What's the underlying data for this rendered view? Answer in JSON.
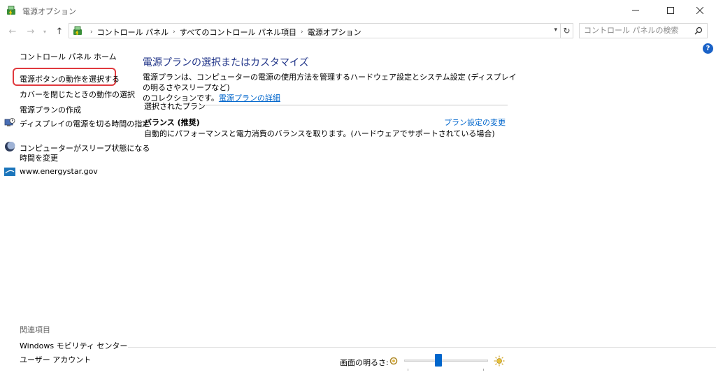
{
  "window": {
    "title": "電源オプション",
    "accent": "#1e3287"
  },
  "address": {
    "crumbs": [
      "コントロール パネル",
      "すべてのコントロール パネル項目",
      "電源オプション"
    ],
    "search_placeholder": "コントロール パネルの検索"
  },
  "help": {
    "label": "?"
  },
  "sidebar": {
    "home": "コントロール パネル ホーム",
    "items": [
      {
        "label": "電源ボタンの動作を選択する",
        "icon": ""
      },
      {
        "label": "カバーを閉じたときの動作の選択",
        "icon": ""
      },
      {
        "label": "電源プランの作成",
        "icon": ""
      },
      {
        "label": "ディスプレイの電源を切る時間の指定",
        "icon": "monitor-clock-icon"
      },
      {
        "label": "コンピューターがスリープ状態になる時間を変更",
        "label_line1": "コンピューターがスリープ状態になる",
        "label_line2": "時間を変更",
        "icon": "moon-icon"
      },
      {
        "label": "www.energystar.gov",
        "icon": "energystar-icon"
      }
    ],
    "related_title": "関連項目",
    "related": [
      "Windows モビリティ センター",
      "ユーザー アカウント"
    ]
  },
  "main": {
    "heading": "電源プランの選択またはカスタマイズ",
    "desc_line1": "電源プランは、コンピューターの電源の使用方法を管理するハードウェア設定とシステム設定 (ディスプレイの明るさやスリープなど)",
    "desc_line2": "のコレクションです。",
    "desc_link": "電源プランの詳細",
    "section_title": "選択されたプラン",
    "plan": {
      "name": "バランス (推奨)",
      "change_link": "プラン設定の変更",
      "description": "自動的にパフォーマンスと電力消費のバランスを取ります。(ハードウェアでサポートされている場合)"
    }
  },
  "footer": {
    "brightness_label": "画面の明るさ:",
    "brightness_value": 0.4
  }
}
